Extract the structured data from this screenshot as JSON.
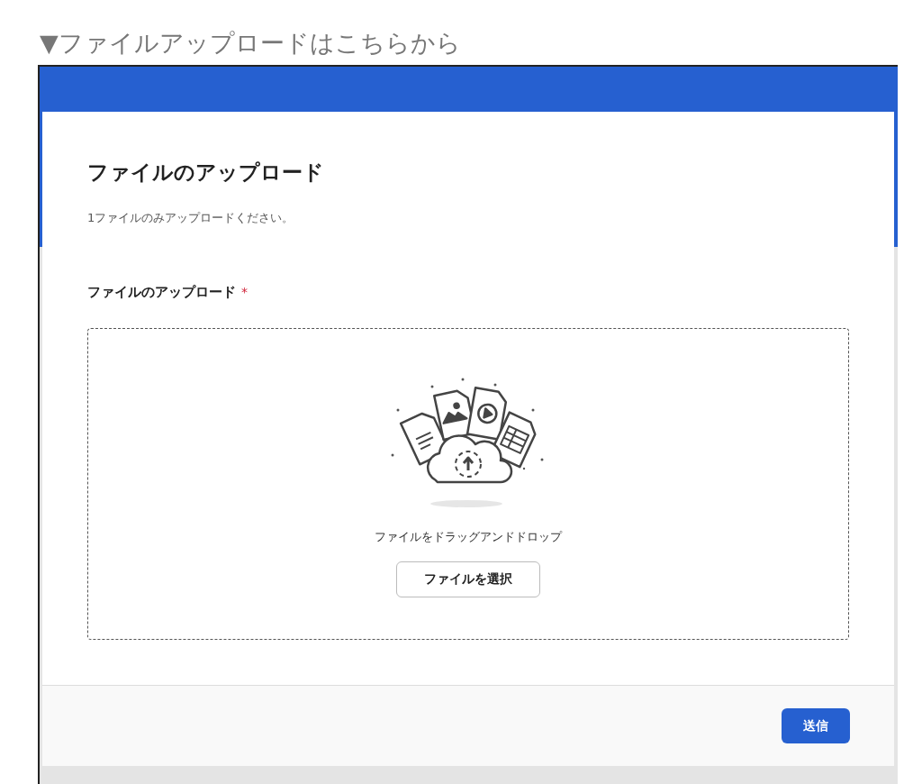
{
  "page_heading": "▼ファイルアップロードはこちらから",
  "form": {
    "title": "ファイルのアップロード",
    "description": "1ファイルのみアップロードください。",
    "field": {
      "label": "ファイルのアップロード",
      "required": true,
      "required_mark": "*",
      "dropzone_text": "ファイルをドラッグアンドドロップ",
      "select_button": "ファイルを選択"
    },
    "submit_button": "送信"
  }
}
